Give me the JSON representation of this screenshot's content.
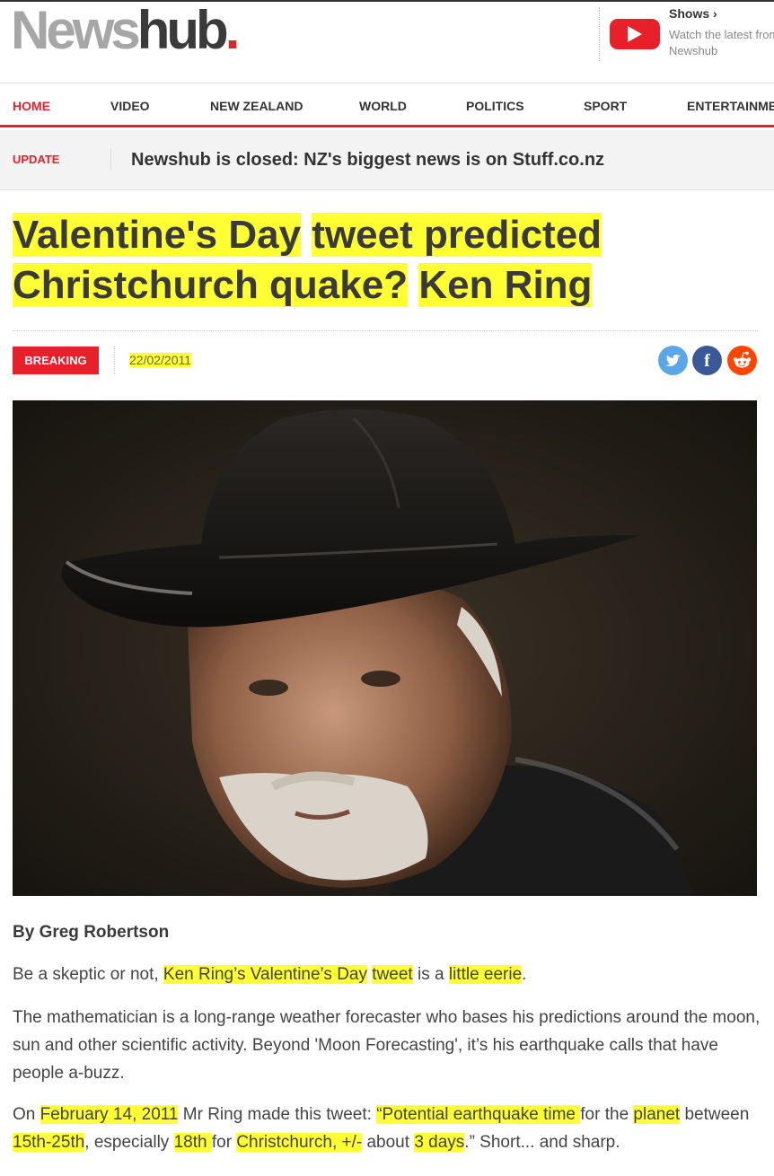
{
  "header": {
    "logo_part1": "News",
    "logo_part2": "hub",
    "logo_dot": ".",
    "shows_title": "Shows ›",
    "shows_subtitle": "Watch the latest from Newshub"
  },
  "nav": {
    "items": [
      {
        "label": "HOME",
        "active": true
      },
      {
        "label": "VIDEO"
      },
      {
        "label": "NEW ZEALAND"
      },
      {
        "label": "WORLD"
      },
      {
        "label": "POLITICS"
      },
      {
        "label": "SPORT"
      },
      {
        "label": "ENTERTAINMENT"
      }
    ]
  },
  "update": {
    "label": "UPDATE",
    "text": "Newshub is closed: NZ's biggest news is on Stuff.co.nz"
  },
  "article": {
    "headline": {
      "part1": "Valentine's Day",
      "part2": "tweet predicted",
      "part3": "Christchurch quake?",
      "part4": "Ken Ring"
    },
    "badge": "BREAKING",
    "date": "22/02/2011",
    "share": {
      "twitter": "twitter-icon",
      "facebook": "facebook-icon",
      "reddit": "reddit-icon"
    },
    "image_alt": "Man with grey beard wearing a dark cowboy hat",
    "byline": "By Greg Robertson",
    "p1": {
      "a": "Be a skeptic or not, ",
      "b": "Ken Ring’s Valentine’s Day",
      "c": " ",
      "d": "tweet",
      "e": " is a ",
      "f": "little eerie",
      "g": "."
    },
    "p2": "The mathematician is a long-range weather forecaster who bases his predictions around the moon, sun and other scientific activity. Beyond 'Moon Forecasting', it’s his earthquake calls that have people a-buzz.",
    "p3": {
      "a": "On ",
      "b": "February 14, 2011",
      "c": " Mr Ring made this tweet: ",
      "d": "“Potential earthquake time ",
      "e": "for the ",
      "f": "planet",
      "g": " between ",
      "h": "15th-25th",
      "i": ", especially ",
      "j": "18th ",
      "k": "for ",
      "l": "Christchurch, +/-",
      "m": " about ",
      "n": "3 days",
      "o": ".” Short... and sharp."
    }
  },
  "colors": {
    "brand_red": "#e8202a",
    "highlight": "#ffff33"
  }
}
